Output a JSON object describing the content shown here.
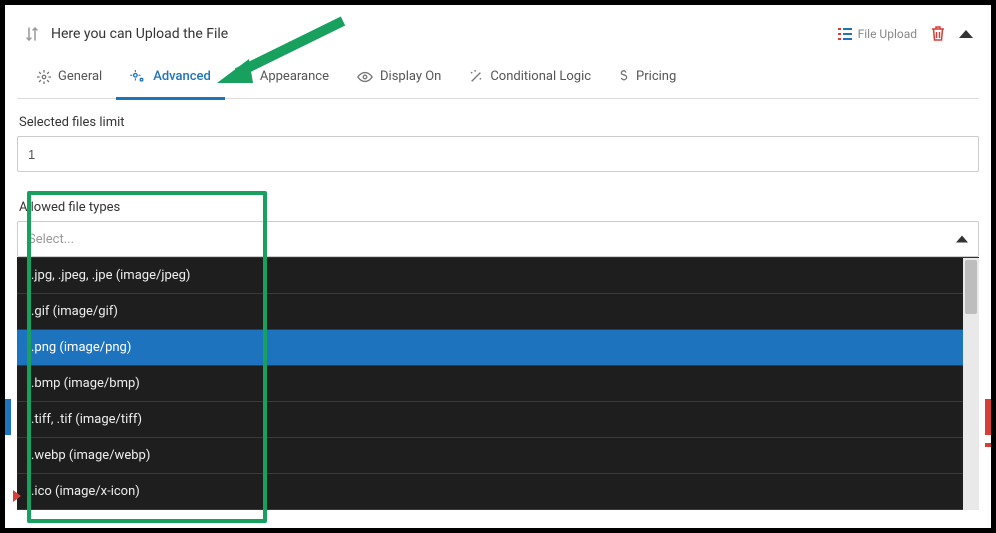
{
  "header": {
    "title": "Here you can Upload the File",
    "type_label": "File Upload"
  },
  "tabs": [
    {
      "label": "General"
    },
    {
      "label": "Advanced"
    },
    {
      "label": "Appearance"
    },
    {
      "label": "Display On"
    },
    {
      "label": "Conditional Logic"
    },
    {
      "label": "Pricing"
    }
  ],
  "selected_files": {
    "label": "Selected files limit",
    "value": "1"
  },
  "allowed": {
    "label": "Allowed file types",
    "placeholder": "Select...",
    "options": [
      ".jpg, .jpeg, .jpe (image/jpeg)",
      ".gif (image/gif)",
      ".png (image/png)",
      ".bmp (image/bmp)",
      ".tiff, .tif (image/tiff)",
      ".webp (image/webp)",
      ".ico (image/x-icon)"
    ],
    "selected_index": 2
  }
}
